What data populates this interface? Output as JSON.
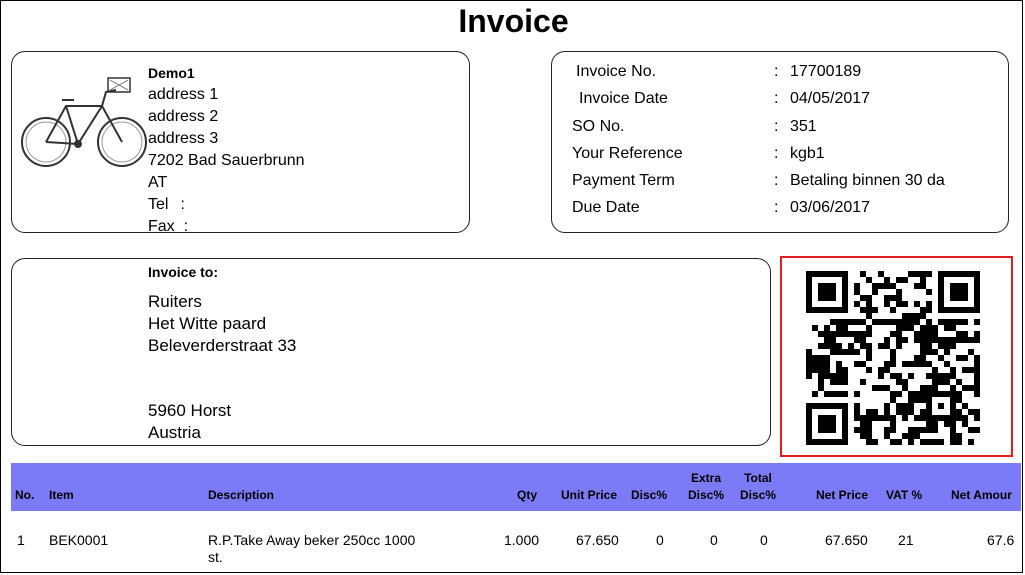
{
  "title": "Invoice",
  "company": {
    "name": "Demo1",
    "lines": [
      "address 1",
      "address 2",
      "address 3",
      "7202 Bad Sauerbrunn",
      "AT"
    ],
    "tel_label": "Tel",
    "fax_label": "Fax",
    "sep": ":",
    "image": "bicycle-image"
  },
  "meta": [
    {
      "label": "Invoice No.",
      "value": "17700189"
    },
    {
      "label": "Invoice Date",
      "value": "04/05/2017"
    },
    {
      "label": "SO No.",
      "value": "351"
    },
    {
      "label": "Your Reference",
      "value": "kgb1"
    },
    {
      "label": "Payment Term",
      "value": "Betaling binnen 30 da"
    },
    {
      "label": "Due Date",
      "value": "03/06/2017"
    }
  ],
  "meta_sep": ":",
  "bill_to": {
    "heading": "Invoice to:",
    "lines": [
      "Ruiters",
      "Het Witte paard",
      "Beleverderstraat 33"
    ],
    "city": "5960 Horst",
    "country": "Austria"
  },
  "qr": {
    "icon": "qr-code-icon",
    "border_color": "#e02020"
  },
  "table": {
    "header_color": "#7b7bf7",
    "headers": {
      "no": "No.",
      "item": "Item",
      "description": "Description",
      "qty": "Qty",
      "unit_price": "Unit Price",
      "disc": "Disc%",
      "extra_disc_1": "Extra",
      "extra_disc_2": "Disc%",
      "total_disc_1": "Total",
      "total_disc_2": "Disc%",
      "net_price": "Net Price",
      "vat": "VAT %",
      "net_amount": "Net Amour"
    },
    "rows": [
      {
        "no": "1",
        "item": "BEK0001",
        "description_1": "R.P.Take Away beker 250cc 1000",
        "description_2": "st.",
        "qty": "1.000",
        "unit_price": "67.650",
        "disc": "0",
        "extra_disc": "0",
        "total_disc": "0",
        "net_price": "67.650",
        "vat": "21",
        "net_amount": "67.6"
      }
    ]
  }
}
